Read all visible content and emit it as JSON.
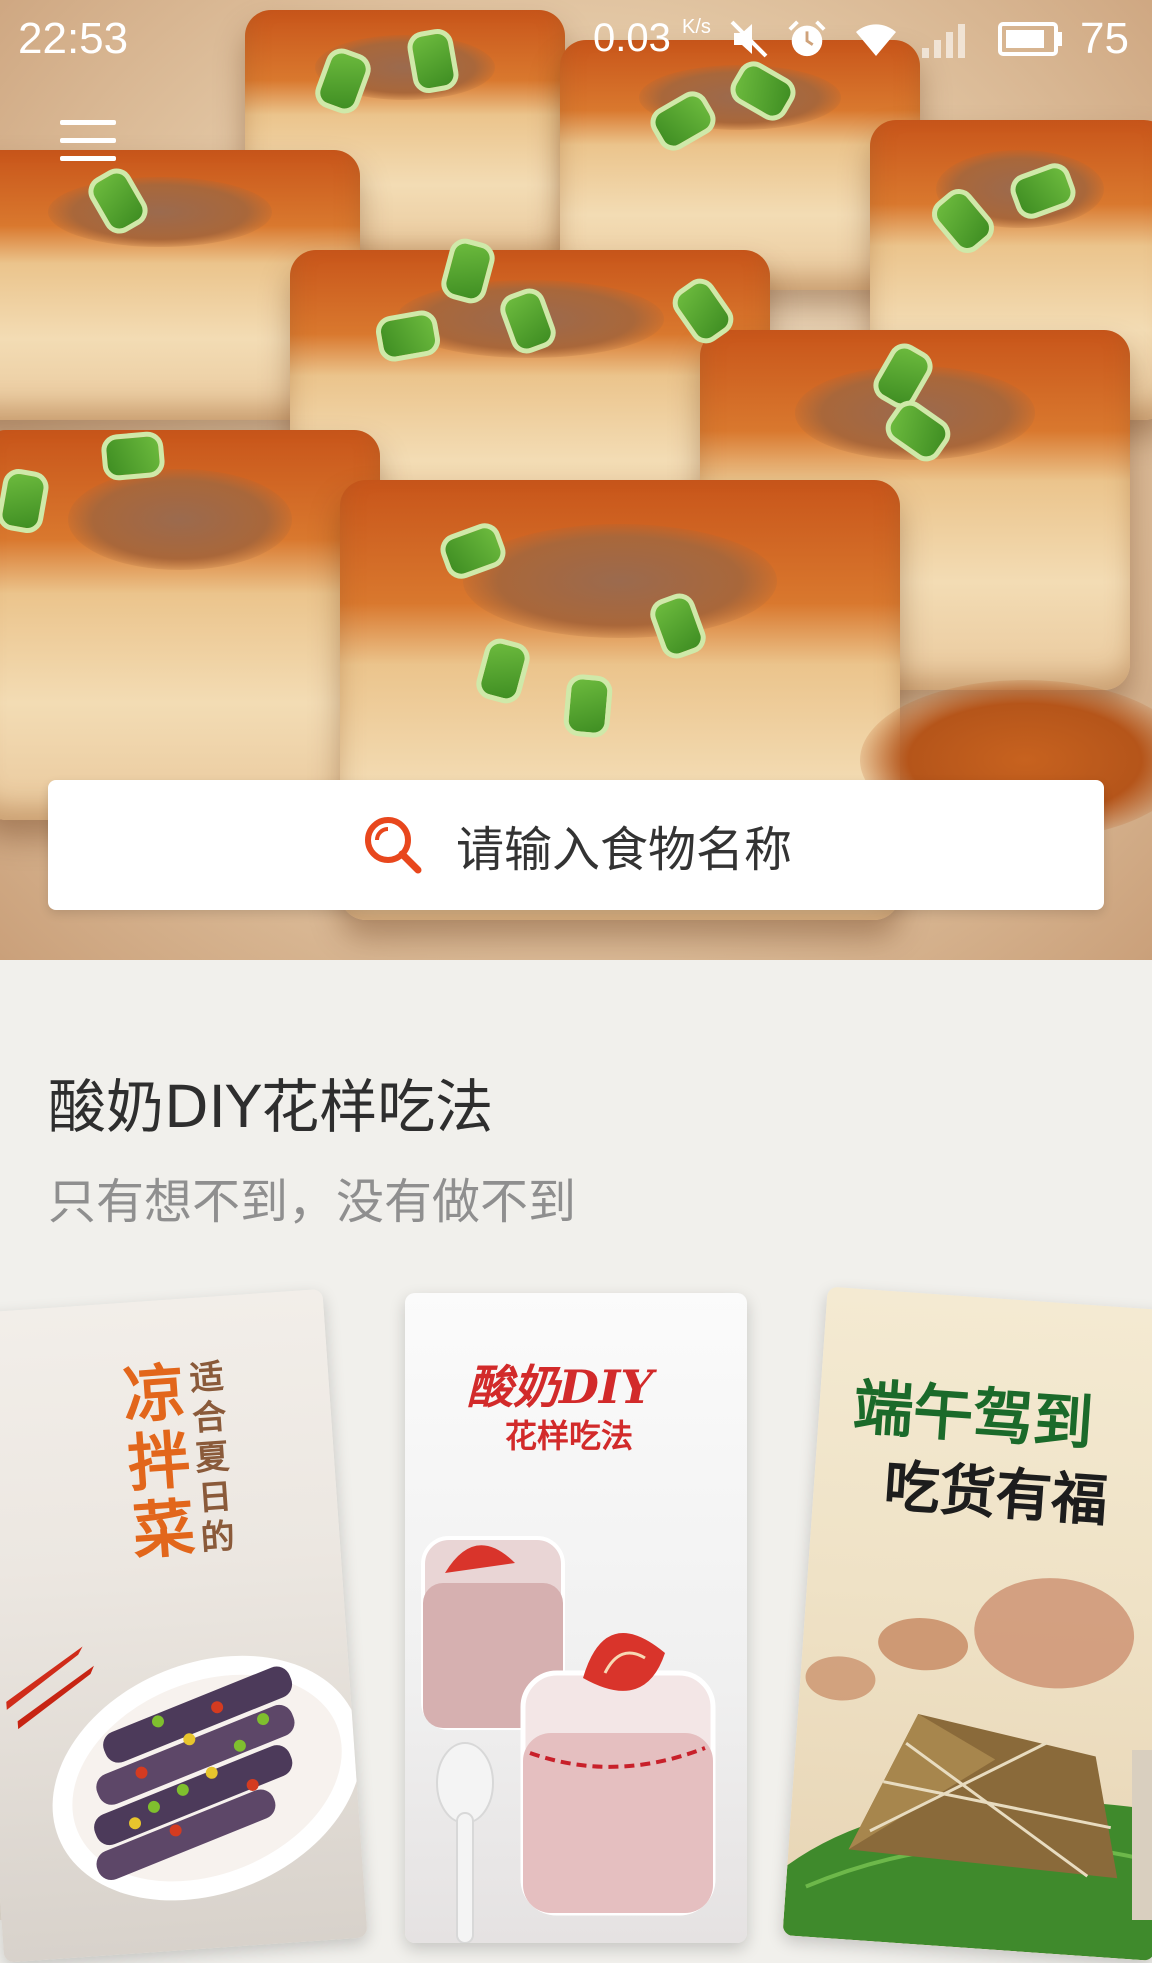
{
  "status_bar": {
    "time": "22:53",
    "net_speed": "0.03",
    "net_speed_unit": "K/s",
    "battery_level": "75",
    "icons": [
      "mute-icon",
      "alarm-icon",
      "wifi-icon",
      "signal-icon",
      "battery-icon"
    ]
  },
  "header": {
    "menu_icon": "hamburger-menu-icon"
  },
  "search": {
    "icon": "search-icon",
    "placeholder": "请输入食物名称",
    "accent_color": "#e8471d"
  },
  "feature": {
    "title": "酸奶DIY花样吃法",
    "subtitle": "只有想不到，没有做不到"
  },
  "cards": [
    {
      "title": "凉拌菜",
      "tagline": "适合夏日的",
      "photo": "eggplant-dish-photo"
    },
    {
      "title": "酸奶DIY",
      "tagline": "花样吃法",
      "photo": "strawberry-yogurt-photo"
    },
    {
      "title": "端午驾到",
      "tagline": "吃货有福",
      "photo": "zongzi-photo"
    }
  ],
  "colors": {
    "background": "#f1f0ec",
    "title_text": "#2e2e2e",
    "subtitle_text": "#8f8f8f"
  }
}
